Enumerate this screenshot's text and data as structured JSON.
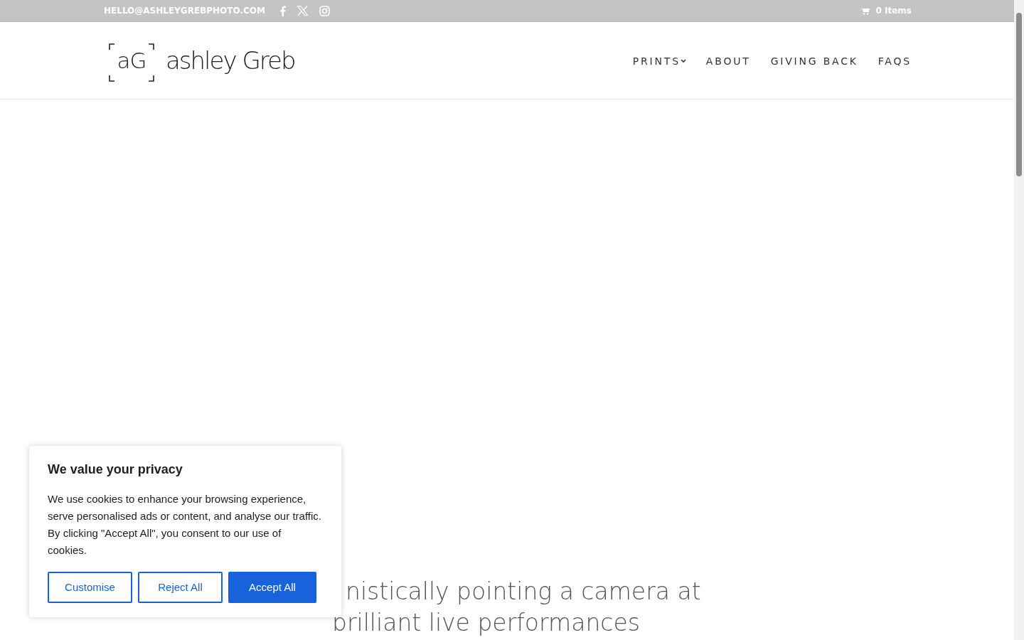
{
  "top_bar": {
    "email": "HELLO@ASHLEYGREBPHOTO.COM",
    "social": [
      {
        "kind": "facebook"
      },
      {
        "kind": "x"
      },
      {
        "kind": "instagram"
      }
    ],
    "cart": "0 Items"
  },
  "header": {
    "logo": {
      "monogram": "aG",
      "name": "ashley Greb"
    },
    "nav": [
      {
        "label": "PRINTS",
        "dropdown": true
      },
      {
        "label": "ABOUT",
        "dropdown": false
      },
      {
        "label": "GIVING BACK",
        "dropdown": false
      },
      {
        "label": "FAQS",
        "dropdown": false
      }
    ]
  },
  "hero": {
    "lines": [
      "nistically pointing a camera at",
      "brilliant live performances"
    ]
  },
  "cookie_banner": {
    "title": "We value your privacy",
    "text": "We use cookies to enhance your browsing experience, serve personalised ads or content, and analyse our traffic. By clicking \"Accept All\", you consent to our use of cookies.",
    "buttons": [
      {
        "label": "Customise",
        "kind": "outline"
      },
      {
        "label": "Reject All",
        "kind": "outline"
      },
      {
        "label": "Accept All",
        "kind": "primary"
      }
    ]
  }
}
